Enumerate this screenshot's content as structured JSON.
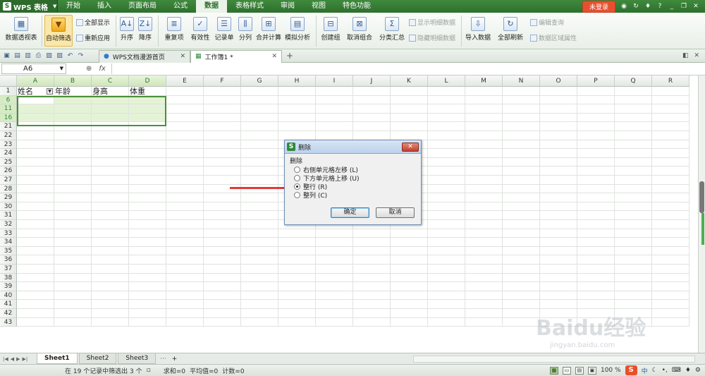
{
  "app": {
    "name": "WPS 表格",
    "login": "未登录"
  },
  "menus": [
    "开始",
    "插入",
    "页面布局",
    "公式",
    "数据",
    "表格样式",
    "审阅",
    "视图",
    "特色功能"
  ],
  "active_menu_index": 4,
  "ribbon": {
    "pivot": "数据透视表",
    "autofilter": "自动筛选",
    "show_all": "全部显示",
    "reapply": "重新应用",
    "sort_asc": "升序",
    "sort_desc": "降序",
    "duplicates": "重复项",
    "validity": "有效性",
    "record_sheet": "记录单",
    "split_col": "分列",
    "consolidate": "合并计算",
    "simulate": "模拟分析",
    "create_group": "创建组",
    "ungroup": "取消组合",
    "subtotal": "分类汇总",
    "show_detail": "显示明细数据",
    "hide_detail": "隐藏明细数据",
    "import_data": "导入数据",
    "refresh_all": "全部刷新",
    "edit_query": "编辑查询",
    "data_prop": "数据区域属性"
  },
  "tabs": [
    {
      "label": "WPS文档漫游首页"
    },
    {
      "label": "工作簿1 *"
    }
  ],
  "formula": {
    "namebox": "A6",
    "fx": "fx"
  },
  "columns": [
    "A",
    "B",
    "C",
    "D",
    "E",
    "F",
    "G",
    "H",
    "I",
    "J",
    "K",
    "L",
    "M",
    "N",
    "O",
    "P",
    "Q",
    "R"
  ],
  "rows": [
    "1",
    "6",
    "11",
    "16",
    "21",
    "22",
    "23",
    "24",
    "25",
    "26",
    "27",
    "28",
    "29",
    "30",
    "31",
    "32",
    "33",
    "34",
    "35",
    "36",
    "37",
    "38",
    "39",
    "40",
    "41",
    "42",
    "43"
  ],
  "header_row": [
    "姓名",
    "年龄",
    "身高",
    "体重"
  ],
  "dialog": {
    "title": "删除",
    "group": "删除",
    "options": [
      "右侧单元格左移 (L)",
      "下方单元格上移 (U)",
      "整行 (R)",
      "整列 (C)"
    ],
    "selected_index": 2,
    "ok": "确定",
    "cancel": "取消"
  },
  "sheets": [
    "Sheet1",
    "Sheet2",
    "Sheet3"
  ],
  "status": {
    "filter_text": "在 19 个记录中筛选出 3 个",
    "sum": "求和=0",
    "avg": "平均值=0",
    "count": "计数=0",
    "zoom": "100 %"
  },
  "watermark": {
    "brand": "Baidu经验",
    "url": "jingyan.baidu.com"
  }
}
